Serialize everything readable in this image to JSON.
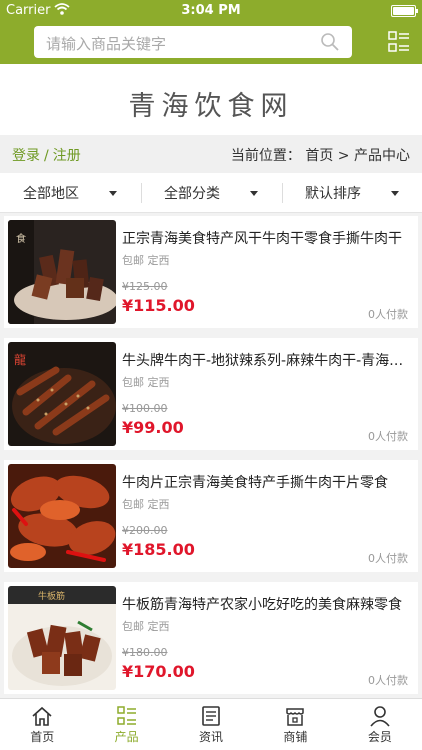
{
  "status": {
    "carrier": "Carrier",
    "time": "3:04 PM"
  },
  "search": {
    "placeholder": "请输入商品关键字"
  },
  "site": {
    "title": "青海饮食网"
  },
  "auth": {
    "login": "登录",
    "sep": "/",
    "register": "注册"
  },
  "breadcrumb": {
    "text": "当前位置： 首页 > 产品中心"
  },
  "filters": [
    {
      "label": "全部地区"
    },
    {
      "label": "全部分类"
    },
    {
      "label": "默认排序"
    }
  ],
  "products": [
    {
      "name": "正宗青海美食特产风干牛肉干零食手撕牛肉干",
      "tag": "包邮 定西",
      "old_price": "¥125.00",
      "price": "¥115.00",
      "paid": "0人付款"
    },
    {
      "name": "牛头牌牛肉干-地狱辣系列-麻辣牛肉干-青海特产",
      "tag": "包邮 定西",
      "old_price": "¥100.00",
      "price": "¥99.00",
      "paid": "0人付款"
    },
    {
      "name": "牛肉片正宗青海美食特产手撕牛肉干片零食",
      "tag": "包邮 定西",
      "old_price": "¥200.00",
      "price": "¥185.00",
      "paid": "0人付款"
    },
    {
      "name": "牛板筋青海特产农家小吃好吃的美食麻辣零食",
      "tag": "包邮 定西",
      "old_price": "¥180.00",
      "price": "¥170.00",
      "paid": "0人付款"
    }
  ],
  "tabbar": [
    {
      "label": "首页",
      "icon": "home-icon"
    },
    {
      "label": "产品",
      "icon": "product-list-icon"
    },
    {
      "label": "资讯",
      "icon": "news-icon"
    },
    {
      "label": "商铺",
      "icon": "shop-icon"
    },
    {
      "label": "会员",
      "icon": "user-icon"
    }
  ],
  "colors": {
    "brand": "#8dac2c",
    "price": "#e0162b",
    "link": "#6f9a24"
  }
}
